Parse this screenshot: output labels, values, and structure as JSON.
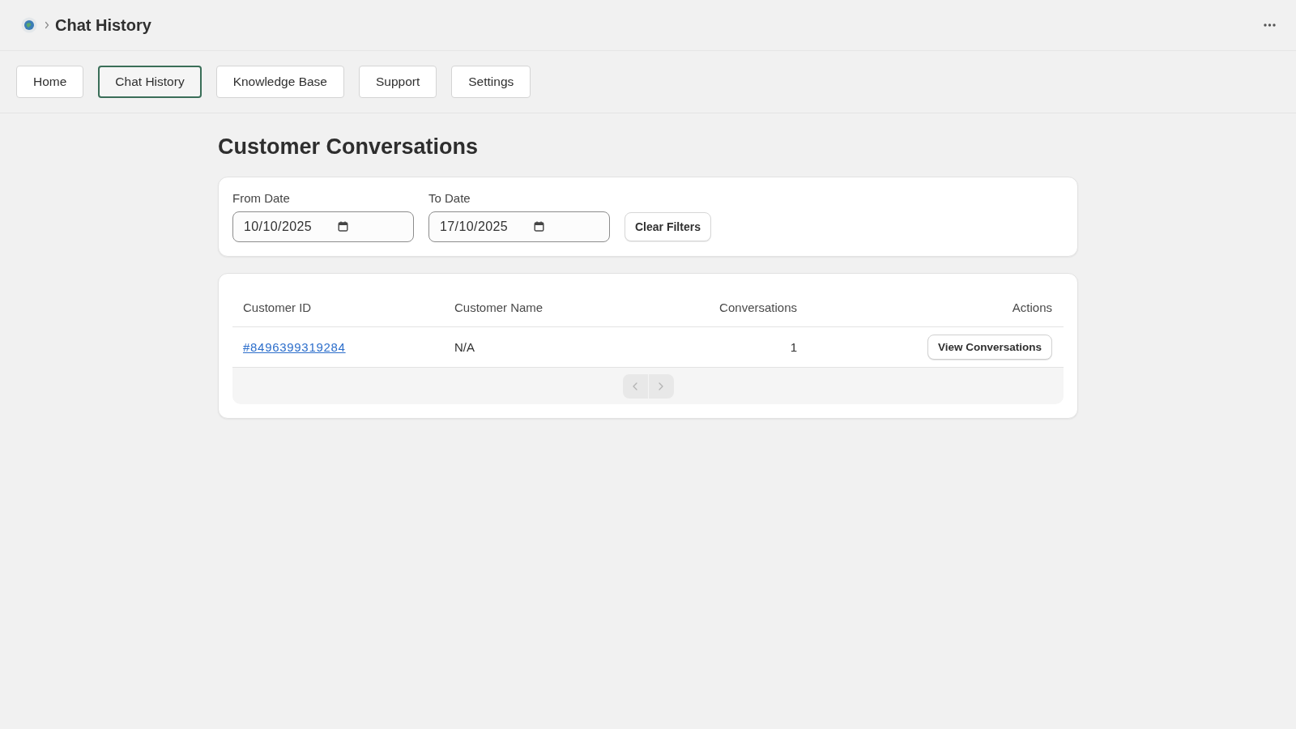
{
  "header": {
    "title": "Chat History"
  },
  "tabs": [
    {
      "label": "Home",
      "selected": false
    },
    {
      "label": "Chat History",
      "selected": true
    },
    {
      "label": "Knowledge Base",
      "selected": false
    },
    {
      "label": "Support",
      "selected": false
    },
    {
      "label": "Settings",
      "selected": false
    }
  ],
  "page_title": "Customer Conversations",
  "filters": {
    "fields": [
      {
        "label": "From Date",
        "value": "10/10/2025"
      },
      {
        "label": "To Date",
        "value": "17/10/2025"
      }
    ],
    "clear_button": "Clear Filters"
  },
  "table": {
    "columns": [
      "Customer ID",
      "Customer Name",
      "Conversations",
      "Actions"
    ],
    "rows": [
      {
        "cells": [
          {
            "kind": "link",
            "text": "#8496399319284"
          },
          {
            "kind": "text",
            "text": "N/A"
          },
          {
            "kind": "number",
            "text": "1"
          },
          {
            "kind": "button",
            "text": "View Conversations"
          }
        ]
      }
    ],
    "pagination": [
      {
        "kind": "previous",
        "disabled": true
      },
      {
        "kind": "next",
        "disabled": true
      }
    ]
  }
}
